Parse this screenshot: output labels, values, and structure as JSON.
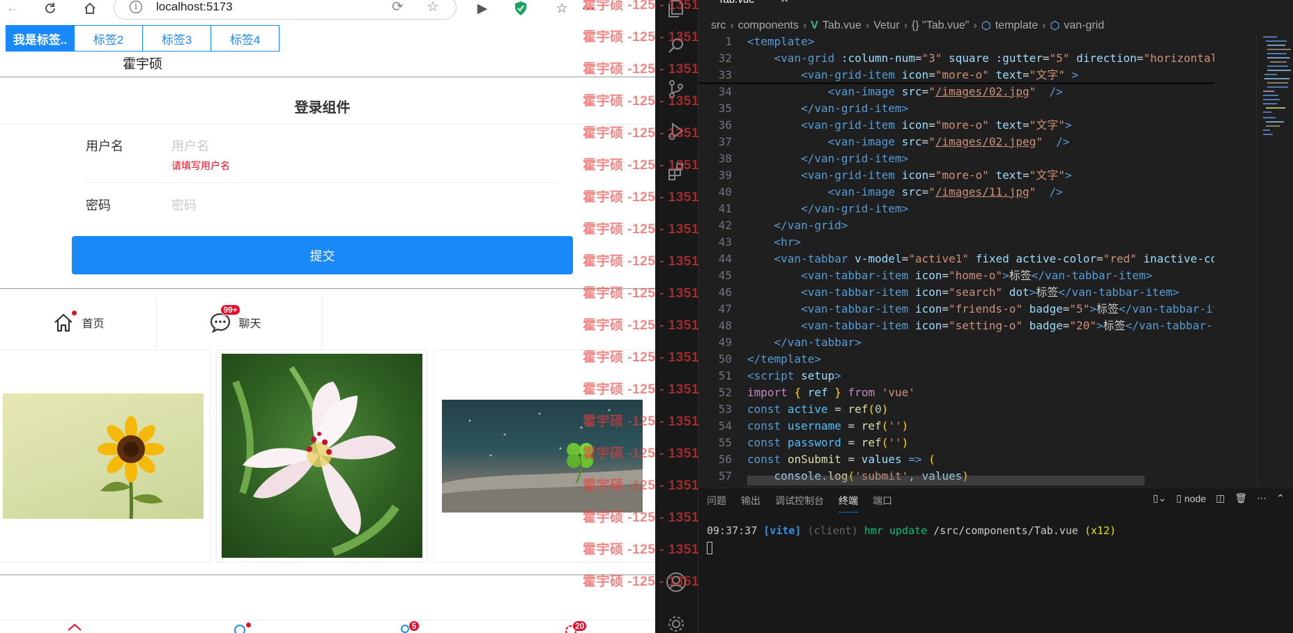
{
  "browser": {
    "url": "localhost:5173",
    "tabs": [
      {
        "label": "我是标签..",
        "active": true
      },
      {
        "label": "标签2",
        "active": false
      },
      {
        "label": "标签3",
        "active": false
      },
      {
        "label": "标签4",
        "active": false
      }
    ],
    "username_display": "霍宇硕",
    "form": {
      "title": "登录组件",
      "username_label": "用户名",
      "username_placeholder": "用户名",
      "username_error": "请填写用户名",
      "password_label": "密码",
      "password_placeholder": "密码",
      "submit_label": "提交"
    },
    "tabbar": [
      {
        "label": "首页",
        "icon": "home-icon",
        "dot": true
      },
      {
        "label": "聊天",
        "icon": "chat-icon",
        "badge": "99+"
      }
    ],
    "bottom_badges": [
      "5",
      "20"
    ],
    "colors": {
      "primary": "#1989fa",
      "danger": "#ee0a24"
    }
  },
  "watermark": {
    "text": "霍宇硕 -125 - 1351",
    "rows": 19
  },
  "vscode": {
    "tab_title": "Tab.vue",
    "breadcrumbs": [
      "src",
      "components",
      "Tab.vue",
      "Vetur",
      "{} \"Tab.vue\"",
      "template",
      "van-grid"
    ],
    "panel_tabs": [
      "问题",
      "输出",
      "调试控制台",
      "终端",
      "端口"
    ],
    "active_panel_tab": "终端",
    "terminal_name": "node",
    "terminal": {
      "time": "09:37:37",
      "tag": "[vite]",
      "client": "(client)",
      "hmr": "hmr update",
      "path": "/src/components/Tab.vue",
      "count": "(x12)"
    }
  }
}
